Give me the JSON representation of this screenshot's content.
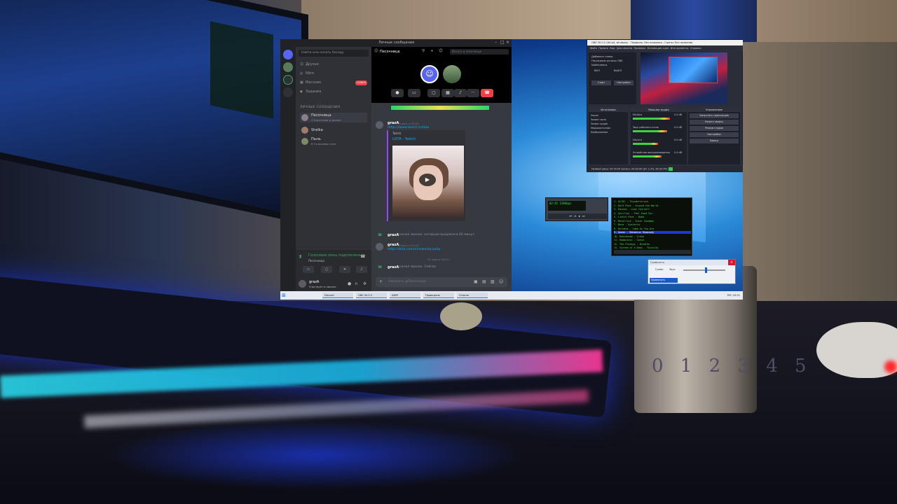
{
  "discord": {
    "title": "Личные сообщения",
    "search_placeholder": "Найти или начать беседу",
    "nav": [
      {
        "icon": "friends-icon",
        "label": "Друзья"
      },
      {
        "icon": "nitro-icon",
        "label": "Nitro"
      },
      {
        "icon": "shop-icon",
        "label": "Магазин",
        "badge": "НОВОЕ"
      },
      {
        "icon": "bonus-icon",
        "label": "Задания"
      }
    ],
    "dm_header": "ЛИЧНЫЕ СООБЩЕНИЯ",
    "dms": [
      {
        "name": "Песочница",
        "status": "3 Участника в звонке",
        "active": true
      },
      {
        "name": "Shelka",
        "status": "",
        "active": false
      },
      {
        "name": "Пыль",
        "status": "В Голосовом чате",
        "active": false
      }
    ],
    "voice": {
      "status": "Голосовая связь подключена",
      "channel": "Песочница"
    },
    "user": {
      "name": "grazA",
      "status": "Участвует в звонке"
    },
    "channel_name": "Песочница",
    "channel_search": "Искать в песочнице",
    "messages": [
      {
        "author": "grazA",
        "time": "Вчера, в 20:05",
        "text": "https://www.twitch.tv/lota",
        "type": "link"
      },
      {
        "author": "grazA",
        "time": "",
        "text": "начал звонок, который продлился 40 минут",
        "type": "system"
      },
      {
        "author": "grazA",
        "time": "Вчера, в 20:47",
        "text": "https://kick.com/mhowesky.lucky",
        "type": "link"
      },
      {
        "author": "grazA",
        "time": "",
        "text": "начал звонок. Сейчас",
        "type": "system"
      }
    ],
    "embed": {
      "provider": "Twitch",
      "title": "LOTA - Twitch"
    },
    "date_divider": "22 марта 2024 г.",
    "input_placeholder": "Написать @Песочница"
  },
  "obs": {
    "title": "OBS 30.0.2 (64-bit, windows) - Профиль: Без названия - Сцены: Без названия",
    "menu": [
      "Файл",
      "Правка",
      "Вид",
      "Док-панели",
      "Профиль",
      "Коллекция сцен",
      "Инструменты",
      "Справка"
    ],
    "side_lines": [
      "Добавить плеер",
      "Последние релизы OBS",
      "Notifications",
      "ВКЛ",
      "ВЫКЛ"
    ],
    "side_buttons": [
      "Старт",
      "Настройки"
    ],
    "panels": {
      "sources": "Источники",
      "mixer": "Микшер аудио",
      "controls": "Управление"
    },
    "sources": [
      "Экран",
      "Захват окна",
      "Захват аудио",
      "Медиаисточник",
      "Изображение"
    ],
    "mixer_rows": [
      {
        "name": "Mic/Aux",
        "db": "0.0 dB",
        "level": 0.72
      },
      {
        "name": "Звук рабочего стола",
        "db": "0.0 dB",
        "level": 0.66
      },
      {
        "name": "Discord",
        "db": "0.0 dB",
        "level": 0.48
      },
      {
        "name": "Устройство воспроизведения",
        "db": "0.0 dB",
        "level": 0.55
      }
    ],
    "controls": [
      "Запустить трансляцию",
      "Начать запись",
      "Режим студии",
      "Настройки",
      "Выход"
    ],
    "status": "Прямой эфир: 00:00:00   Запись: 00:00:00   ЦП: 2.3%, 60.00 FPS"
  },
  "aimp": {
    "display": "02:41  128kbps",
    "buttons": "⏮ ⏯ ⏹ ⏭",
    "playlist": [
      "1. AC/DC - Thunderstruck",
      "2. Daft Punk - Around the World",
      "3. Eminem - Lose Yourself",
      "4. Gorillaz - Feel Good Inc.",
      "5. Linkin Park - Numb",
      "6. Metallica - Enter Sandman",
      "7. Muse - Hysteria",
      "8. Nirvana - Come As You Are",
      "9. Queen - Bohemian Rhapsody",
      "10. Radiohead - Creep",
      "11. Rammstein - Sonne",
      "12. The Prodigy - Breathe",
      "13. System of a Down - Toxicity"
    ],
    "selected_index": 8
  },
  "volume": {
    "title": "Громкость",
    "label1": "Громк.",
    "label2": "Звук",
    "level": 0.55,
    "foot": "Применить"
  },
  "taskbar": {
    "tasks": [
      "Discord",
      "OBS 30.0.2",
      "AIMP",
      "Проводник",
      "Chrome"
    ],
    "tray": "РУС  20:51"
  },
  "background": {
    "can_label": "0 1 2 3 4 5"
  }
}
